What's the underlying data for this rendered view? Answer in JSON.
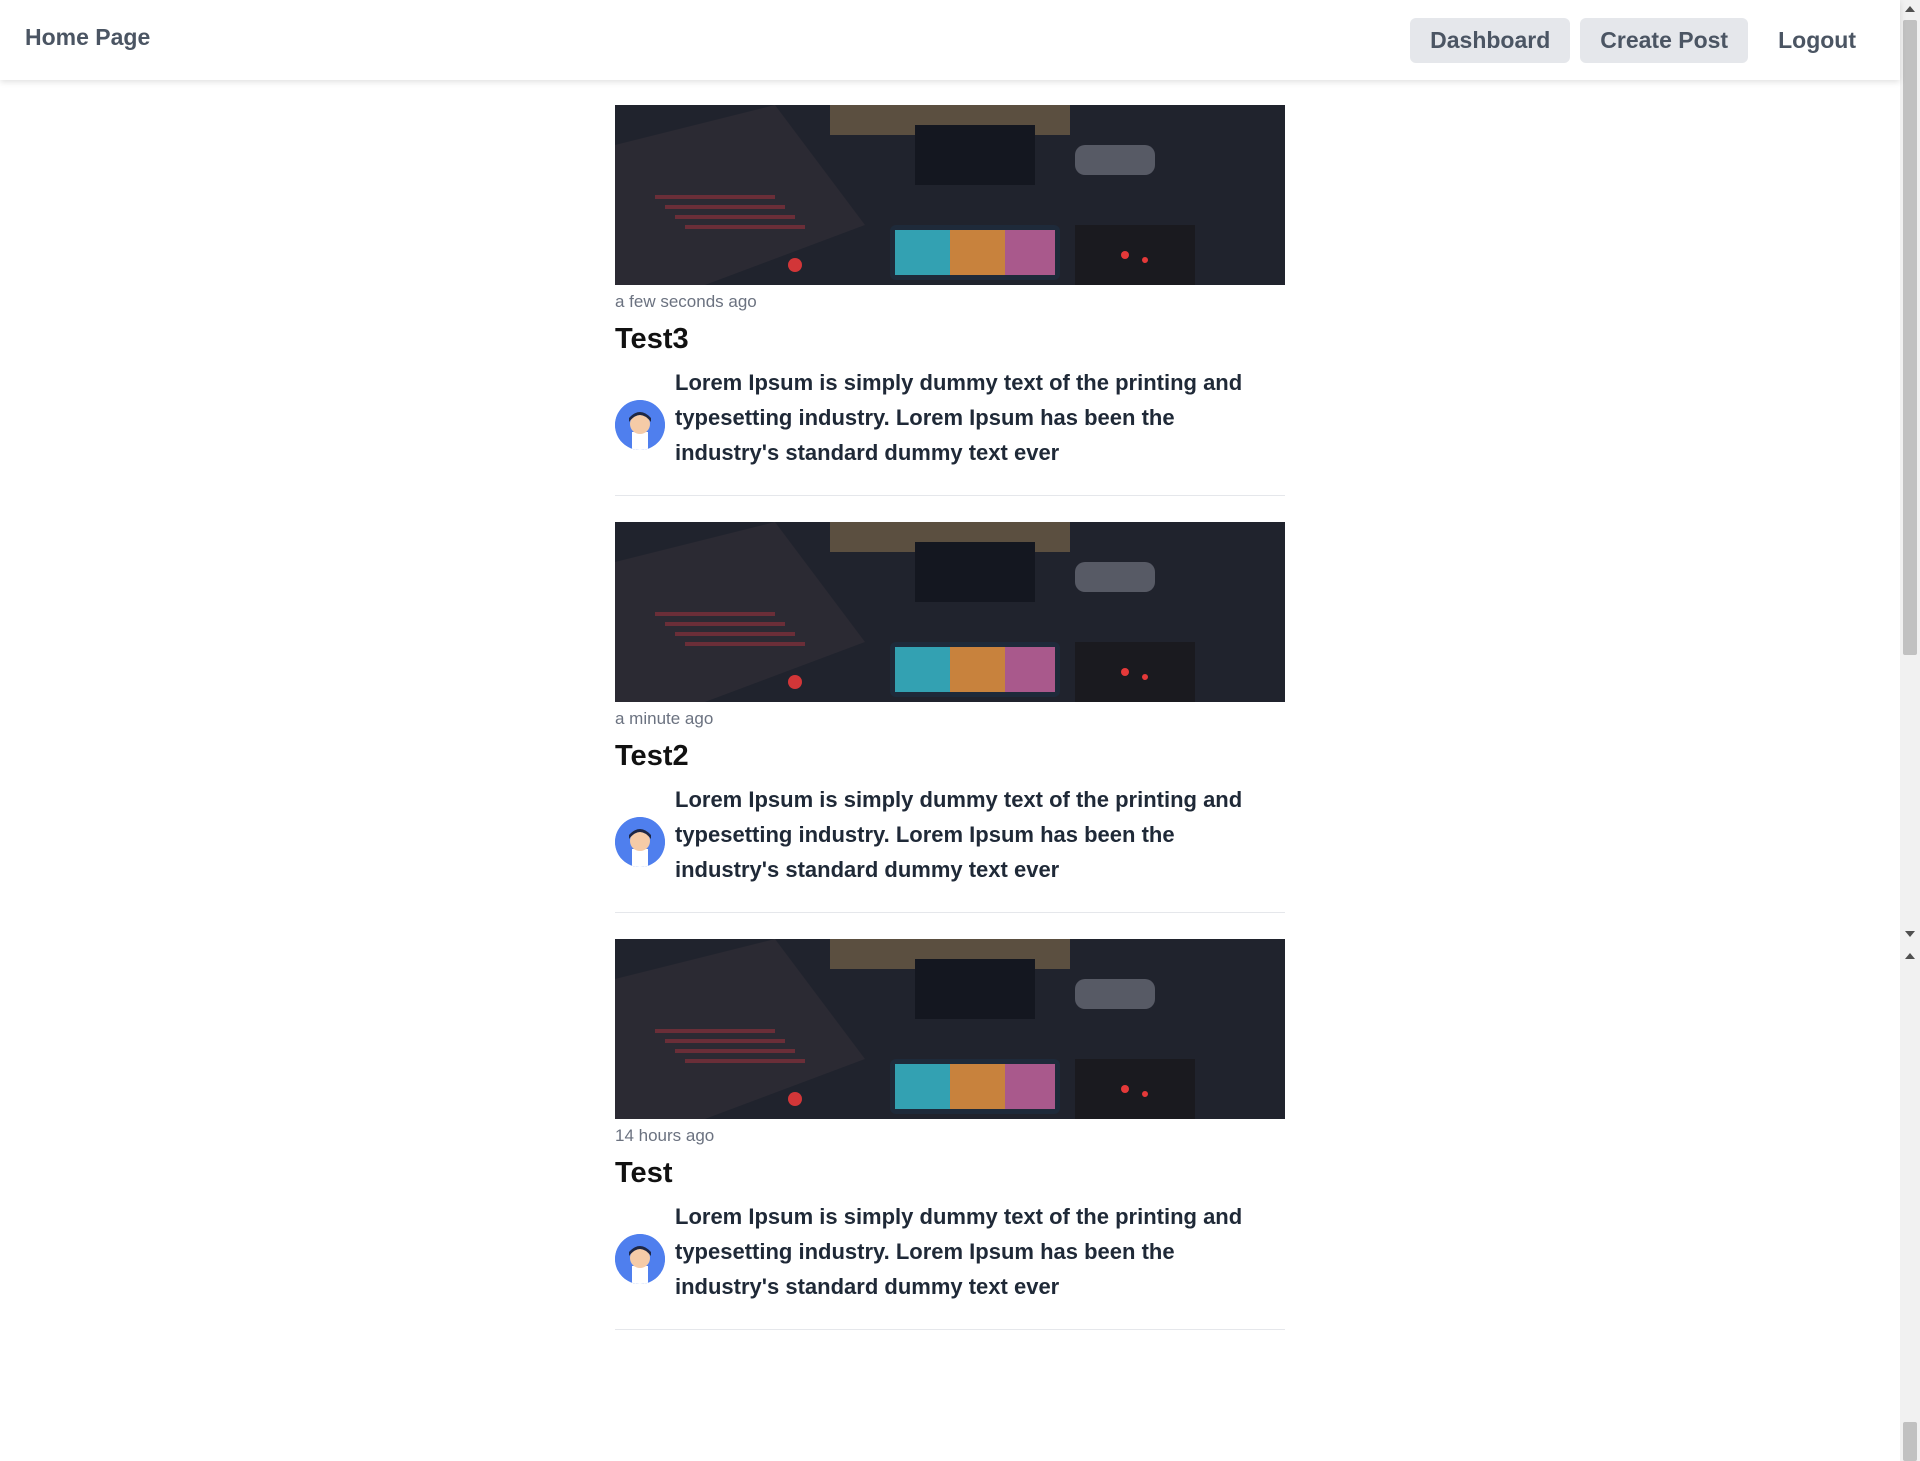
{
  "navbar": {
    "brand": "Home Page",
    "buttons": [
      {
        "label": "Dashboard"
      },
      {
        "label": "Create Post"
      },
      {
        "label": "Logout"
      }
    ]
  },
  "posts": [
    {
      "time": "a few seconds ago",
      "title": "Test3",
      "excerpt": "Lorem Ipsum is simply dummy text of the printing and typesetting industry. Lorem Ipsum has been the industry's standard dummy text ever"
    },
    {
      "time": "a minute ago",
      "title": "Test2",
      "excerpt": "Lorem Ipsum is simply dummy text of the printing and typesetting industry. Lorem Ipsum has been the industry's standard dummy text ever"
    },
    {
      "time": "14 hours ago",
      "title": "Test",
      "excerpt": "Lorem Ipsum is simply dummy text of the printing and typesetting industry. Lorem Ipsum has been the industry's standard dummy text ever"
    }
  ],
  "colors": {
    "avatar_bg": "#4f7fee",
    "button_bg": "#e5e7eb",
    "brand_text": "#4b5563"
  }
}
